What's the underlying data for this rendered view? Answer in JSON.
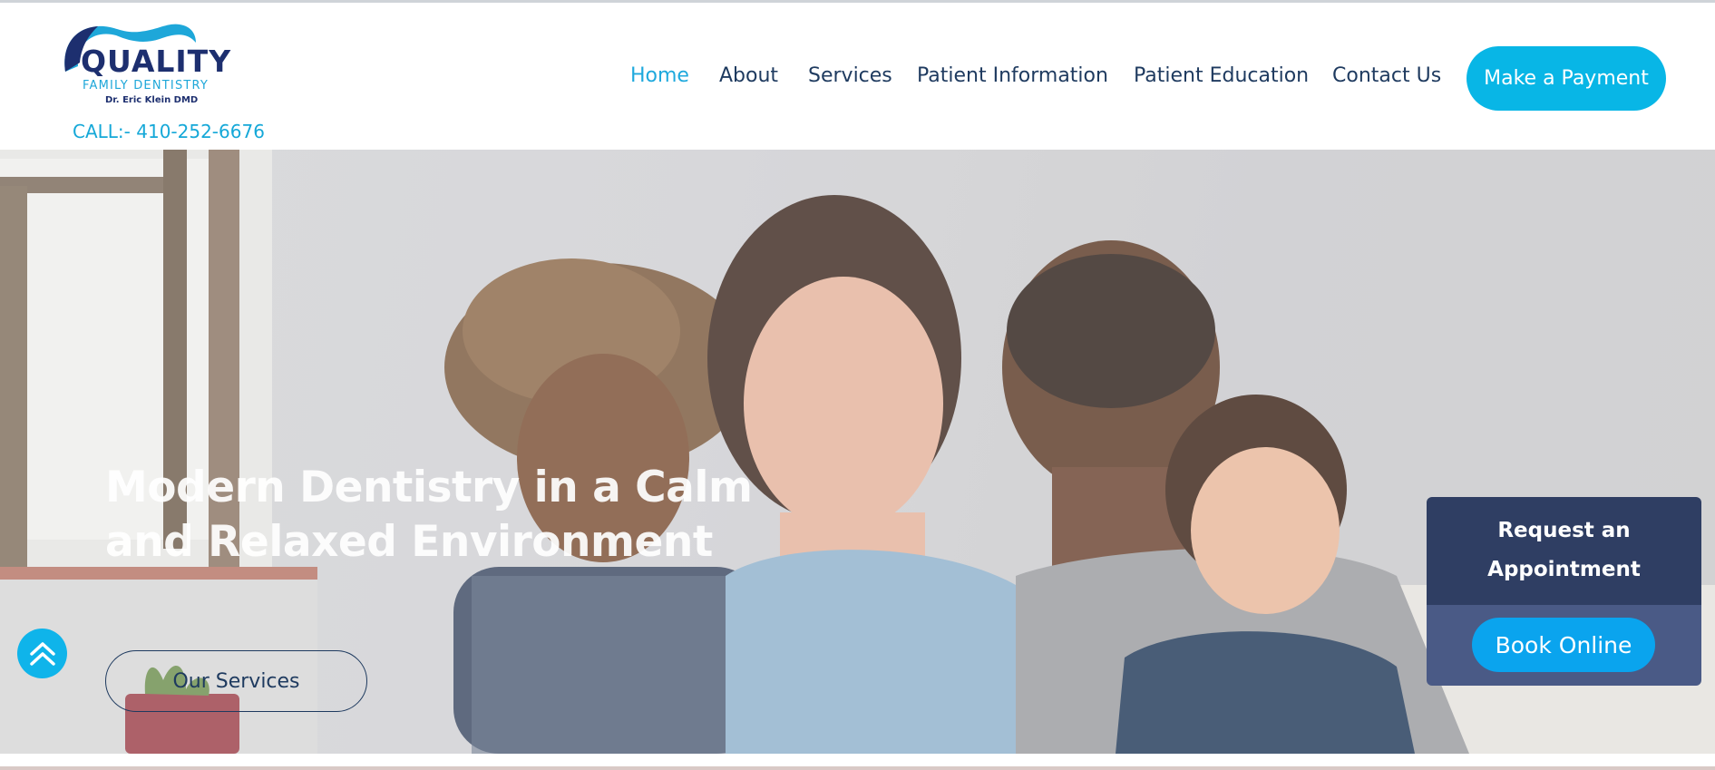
{
  "header": {
    "logo": {
      "title": "QUALITY",
      "subtitle": "FAMILY DENTISTRY",
      "doctor": "Dr. Eric Klein DMD"
    },
    "phone": "CALL:- 410-252-6676",
    "nav": [
      {
        "label": "Home",
        "active": true
      },
      {
        "label": "About",
        "active": false
      },
      {
        "label": "Services",
        "active": false
      },
      {
        "label": "Patient Information",
        "active": false
      },
      {
        "label": "Patient Education",
        "active": false
      },
      {
        "label": "Contact Us",
        "active": false
      }
    ],
    "payment_button": "Make a Payment"
  },
  "hero": {
    "headline": "Modern Dentistry in a Calm and Relaxed Environment",
    "services_button": "Our Services",
    "scroll_top_icon": "double-chevron-up-icon"
  },
  "appointment": {
    "title": "Request an Appointment",
    "book_button": "Book Online"
  },
  "colors": {
    "accent": "#08b6e6",
    "navy": "#1e3a5f",
    "panel_dark": "#2f3e63",
    "panel_light": "#4a5a86"
  }
}
